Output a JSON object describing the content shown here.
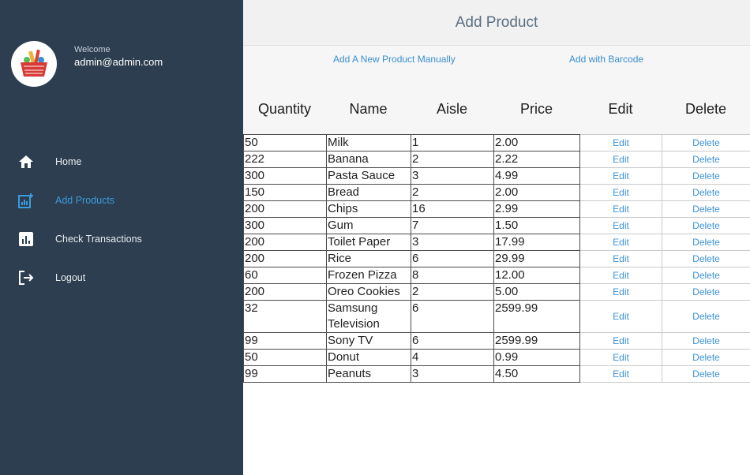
{
  "sidebar": {
    "welcome": "Welcome",
    "user": "admin@admin.com",
    "items": [
      {
        "label": "Home",
        "icon": "home-icon",
        "active": false
      },
      {
        "label": "Add Products",
        "icon": "add-chart-icon",
        "active": true
      },
      {
        "label": "Check Transactions",
        "icon": "bar-chart-icon",
        "active": false
      },
      {
        "label": "Logout",
        "icon": "logout-icon",
        "active": false
      }
    ],
    "colors": {
      "background": "#2c3e50",
      "active": "#3b9bdc"
    }
  },
  "header": {
    "title": "Add Product"
  },
  "actions": {
    "manual": "Add A New Product Manually",
    "barcode": "Add with Barcode"
  },
  "table": {
    "columns": [
      "Quantity",
      "Name",
      "Aisle",
      "Price",
      "Edit",
      "Delete"
    ],
    "edit_label": "Edit",
    "delete_label": "Delete",
    "rows": [
      {
        "quantity": "50",
        "name": "Milk",
        "aisle": "1",
        "price": "2.00"
      },
      {
        "quantity": "222",
        "name": "Banana",
        "aisle": "2",
        "price": "2.22"
      },
      {
        "quantity": "300",
        "name": "Pasta Sauce",
        "aisle": "3",
        "price": "4.99"
      },
      {
        "quantity": "150",
        "name": "Bread",
        "aisle": "2",
        "price": "2.00"
      },
      {
        "quantity": "200",
        "name": "Chips",
        "aisle": "16",
        "price": "2.99"
      },
      {
        "quantity": "300",
        "name": "Gum",
        "aisle": "7",
        "price": "1.50"
      },
      {
        "quantity": "200",
        "name": "Toilet Paper",
        "aisle": "3",
        "price": "17.99"
      },
      {
        "quantity": "200",
        "name": "Rice",
        "aisle": "6",
        "price": "29.99"
      },
      {
        "quantity": "60",
        "name": "Frozen Pizza",
        "aisle": "8",
        "price": "12.00"
      },
      {
        "quantity": "200",
        "name": "Oreo Cookies",
        "aisle": "2",
        "price": "5.00"
      },
      {
        "quantity": "32",
        "name": "Samsung Television",
        "aisle": "6",
        "price": "2599.99"
      },
      {
        "quantity": "99",
        "name": "Sony TV",
        "aisle": "6",
        "price": "2599.99"
      },
      {
        "quantity": "50",
        "name": "Donut",
        "aisle": "4",
        "price": "0.99"
      },
      {
        "quantity": "99",
        "name": "Peanuts",
        "aisle": "3",
        "price": "4.50"
      }
    ]
  }
}
